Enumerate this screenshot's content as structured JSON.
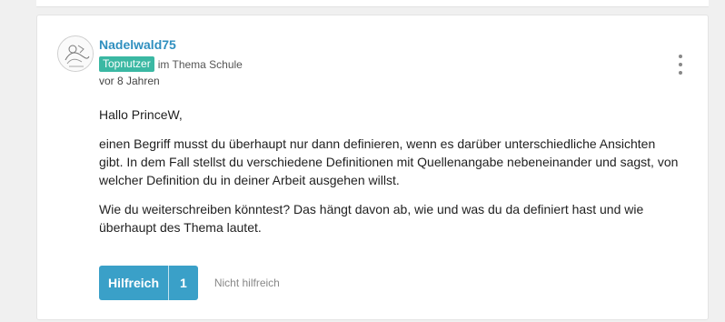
{
  "post": {
    "author": "Nadelwald75",
    "badge": "Topnutzer",
    "topic_text": "im Thema Schule",
    "time": "vor 8 Jahren",
    "body": {
      "greeting": "Hallo PrinceW,",
      "paragraph1": "einen Begriff musst du überhaupt nur dann definieren, wenn es darüber unterschiedliche Ansichten gibt. In dem Fall stellst du verschiedene Definitionen mit Quellenangabe nebeneinander und sagst, von welcher Definition du in deiner Arbeit ausgehen willst.",
      "paragraph2": "Wie du weiterschreiben könntest? Das hängt davon ab, wie und was du da definiert hast und wie überhaupt des Thema lautet."
    },
    "actions": {
      "helpful_label": "Hilfreich",
      "helpful_count": "1",
      "not_helpful_label": "Nicht hilfreich"
    }
  },
  "icons": {
    "avatar": "avatar-drawing",
    "more": "more-vertical-icon"
  },
  "colors": {
    "author_link": "#2f8fbf",
    "badge": "#3bb8a3",
    "helpful_button": "#3aa0c8"
  }
}
